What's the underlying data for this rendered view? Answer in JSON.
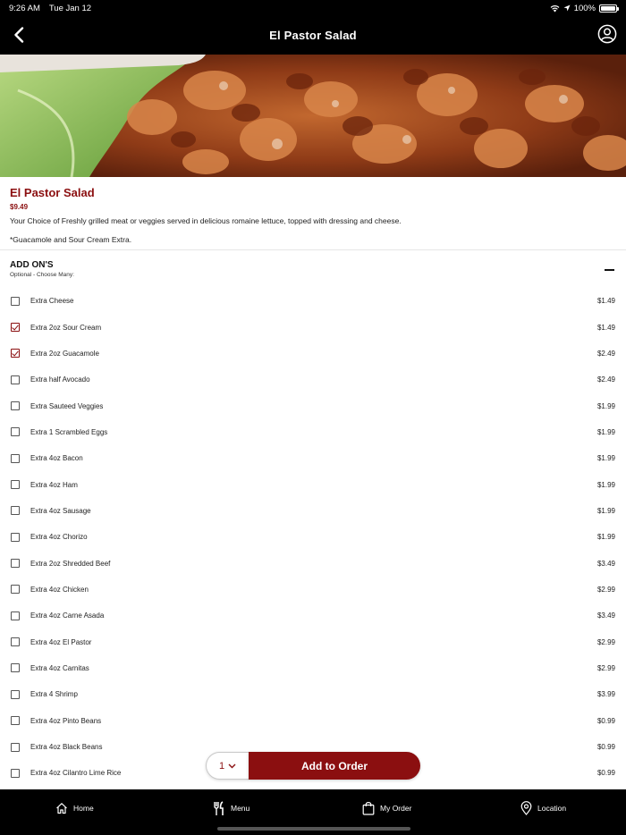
{
  "status": {
    "time": "9:26 AM",
    "date": "Tue Jan 12",
    "battery": "100%"
  },
  "nav": {
    "title": "El Pastor Salad"
  },
  "item": {
    "name": "El Pastor Salad",
    "price": "$9.49",
    "description": "Your Choice of Freshly grilled meat or veggies served in delicious romaine lettuce,  topped with dressing and cheese.",
    "note": "*Guacamole and Sour Cream Extra."
  },
  "addons": {
    "title": "ADD ON'S",
    "subtitle": "Optional - Choose Many:",
    "options": [
      {
        "label": "Extra Cheese",
        "price": "$1.49",
        "checked": false
      },
      {
        "label": "Extra 2oz Sour Cream",
        "price": "$1.49",
        "checked": true
      },
      {
        "label": "Extra 2oz Guacamole",
        "price": "$2.49",
        "checked": true
      },
      {
        "label": "Extra half Avocado",
        "price": "$2.49",
        "checked": false
      },
      {
        "label": "Extra Sauteed Veggies",
        "price": "$1.99",
        "checked": false
      },
      {
        "label": "Extra 1 Scrambled Eggs",
        "price": "$1.99",
        "checked": false
      },
      {
        "label": "Extra 4oz Bacon",
        "price": "$1.99",
        "checked": false
      },
      {
        "label": "Extra 4oz Ham",
        "price": "$1.99",
        "checked": false
      },
      {
        "label": "Extra 4oz Sausage",
        "price": "$1.99",
        "checked": false
      },
      {
        "label": "Extra 4oz Chorizo",
        "price": "$1.99",
        "checked": false
      },
      {
        "label": "Extra 2oz Shredded Beef",
        "price": "$3.49",
        "checked": false
      },
      {
        "label": "Extra 4oz Chicken",
        "price": "$2.99",
        "checked": false
      },
      {
        "label": "Extra 4oz Carne Asada",
        "price": "$3.49",
        "checked": false
      },
      {
        "label": "Extra 4oz El Pastor",
        "price": "$2.99",
        "checked": false
      },
      {
        "label": "Extra 4oz Carnitas",
        "price": "$2.99",
        "checked": false
      },
      {
        "label": "Extra 4 Shrimp",
        "price": "$3.99",
        "checked": false
      },
      {
        "label": "Extra 4oz Pinto Beans",
        "price": "$0.99",
        "checked": false
      },
      {
        "label": "Extra 4oz Black Beans",
        "price": "$0.99",
        "checked": false
      },
      {
        "label": "Extra 4oz Cilantro Lime Rice",
        "price": "$0.99",
        "checked": false
      }
    ]
  },
  "order": {
    "quantity": "1",
    "add_label": "Add to Order"
  },
  "tabs": {
    "home": "Home",
    "menu": "Menu",
    "my_order": "My Order",
    "location": "Location"
  },
  "colors": {
    "accent": "#8b0f10",
    "bar": "#000000"
  }
}
